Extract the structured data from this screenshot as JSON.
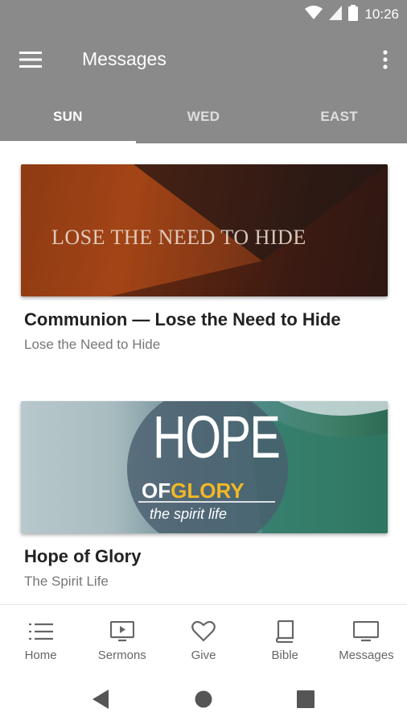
{
  "status_bar": {
    "time": "10:26",
    "icons": [
      "wifi-icon",
      "signal-icon",
      "battery-icon"
    ]
  },
  "app_bar": {
    "title": "Messages",
    "menu_icon": "hamburger-menu-icon",
    "more_icon": "more-vertical-icon"
  },
  "tabs": [
    {
      "label": "SUN",
      "active": true
    },
    {
      "label": "WED",
      "active": false
    },
    {
      "label": "EAST",
      "active": false
    }
  ],
  "cards": [
    {
      "image_text": "LOSE THE NEED TO HIDE",
      "title": "Communion — Lose the Need to Hide",
      "subtitle": "Lose the Need to Hide"
    },
    {
      "image_text_main": "HOPE",
      "image_text_of": "OF",
      "image_text_glory": "GLORY",
      "image_text_tagline": "the spirit life",
      "title": "Hope of Glory",
      "subtitle": "The Spirit Life"
    }
  ],
  "bottom_nav": [
    {
      "label": "Home",
      "icon": "list-icon"
    },
    {
      "label": "Sermons",
      "icon": "video-icon"
    },
    {
      "label": "Give",
      "icon": "heart-icon"
    },
    {
      "label": "Bible",
      "icon": "book-icon"
    },
    {
      "label": "Messages",
      "icon": "monitor-icon"
    }
  ],
  "system_nav": [
    "back-icon",
    "home-circle-icon",
    "recents-square-icon"
  ],
  "colors": {
    "app_bar": "#8a8a8a",
    "tab_indicator": "#ffffff",
    "glory_yellow": "#f2b824"
  }
}
